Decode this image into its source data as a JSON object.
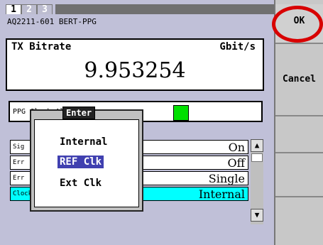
{
  "tabs": [
    "1",
    "2",
    "3"
  ],
  "model": "AQ2211-601 BERT-PPG",
  "bitrate": {
    "label": "TX Bitrate",
    "unit": "Gbit/s",
    "value": "9.953254"
  },
  "alarm": {
    "label": "PPG Clock Alarm",
    "led_color": "#00e000"
  },
  "rows": [
    {
      "label": "Sig",
      "value": "On"
    },
    {
      "label": "Err",
      "value": "Off"
    },
    {
      "label": "Err",
      "value": "Single"
    },
    {
      "label": "Clock Source",
      "value": "Internal"
    }
  ],
  "popup": {
    "badge": "Enter",
    "options": [
      "Internal",
      "REF Clk",
      "Ext Clk"
    ],
    "selected": "REF Clk"
  },
  "side": {
    "ok": "OK",
    "cancel": "Cancel"
  }
}
